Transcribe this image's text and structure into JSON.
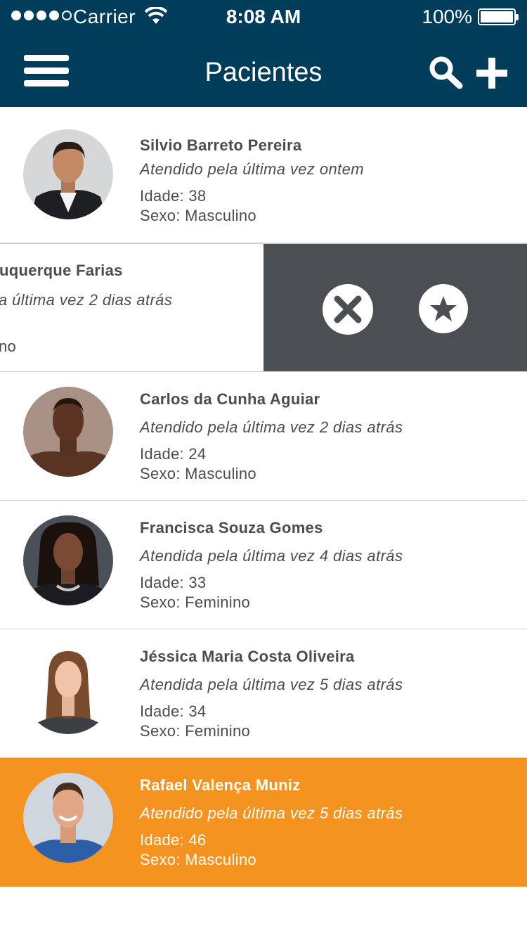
{
  "status_bar": {
    "carrier": "Carrier",
    "time": "8:08 AM",
    "battery": "100%"
  },
  "nav": {
    "title": "Pacientes",
    "menu_icon": "hamburger-menu-icon",
    "search_icon": "search-icon",
    "add_icon": "plus-icon"
  },
  "colors": {
    "nav_bg": "#003d5b",
    "selected_bg": "#f4931f",
    "action_bg": "#4b4f53",
    "text": "#4a4d50"
  },
  "swiped_actions": {
    "delete_icon": "close-circle-icon",
    "favorite_icon": "star-circle-icon"
  },
  "patients": [
    {
      "name": "Silvio Barreto Pereira",
      "last_visit": "Atendido pela última vez ontem",
      "age": "Idade: 38",
      "sex": "Sexo: Masculino"
    },
    {
      "name": "uquerque Farias",
      "last_visit": "a última vez 2 dias atrás",
      "age": "",
      "sex": "no"
    },
    {
      "name": "Carlos da Cunha Aguiar",
      "last_visit": "Atendido pela última vez 2 dias atrás",
      "age": "Idade: 24",
      "sex": "Sexo: Masculino"
    },
    {
      "name": "Francisca Souza Gomes",
      "last_visit": "Atendida pela última vez 4 dias atrás",
      "age": "Idade: 33",
      "sex": "Sexo: Feminino"
    },
    {
      "name": "Jéssica Maria Costa Oliveira",
      "last_visit": "Atendida pela última vez 5 dias atrás",
      "age": "Idade: 34",
      "sex": "Sexo: Feminino"
    },
    {
      "name": "Rafael Valença Muniz",
      "last_visit": "Atendido pela última vez 5 dias atrás",
      "age": "Idade: 46",
      "sex": "Sexo: Masculino"
    }
  ]
}
